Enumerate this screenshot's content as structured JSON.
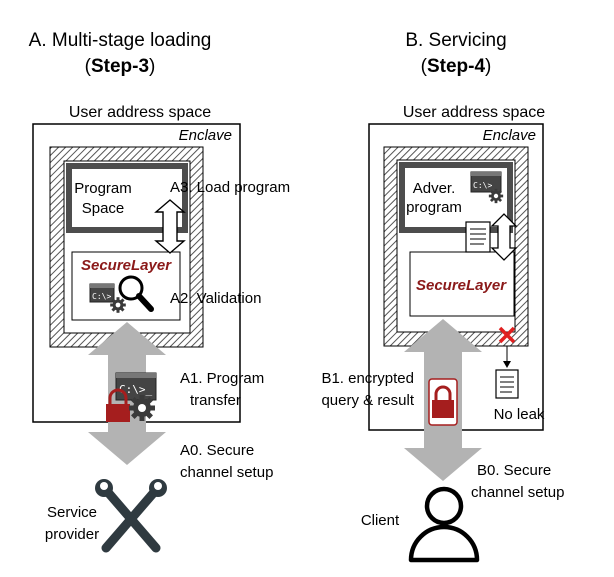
{
  "panel_a": {
    "title": "A. Multi-stage loading",
    "step_label": "Step-3",
    "user_space": "User address space",
    "enclave": "Enclave",
    "program_space_1": "Program",
    "program_space_2": "Space",
    "securelayer": "SecureLayer",
    "a3": "A3. Load program",
    "a2": "A2. Validation",
    "a1_1": "A1. Program",
    "a1_2": "transfer",
    "a0_1": "A0. Secure",
    "a0_2": "channel setup",
    "provider_1": "Service",
    "provider_2": "provider"
  },
  "panel_b": {
    "title": "B. Servicing",
    "step_label": "Step-4",
    "user_space": "User address space",
    "enclave": "Enclave",
    "adver_1": "Adver.",
    "adver_2": "program",
    "securelayer": "SecureLayer",
    "b1_1": "B1. encrypted",
    "b1_2": "query & result",
    "no_leak": "No leak",
    "b0_1": "B0. Secure",
    "b0_2": "channel setup",
    "client": "Client"
  },
  "icons": [
    "terminal-icon",
    "gear-icon",
    "magnifier-icon",
    "padlock-icon",
    "wrench-icon",
    "document-icon",
    "cross-icon",
    "person-icon"
  ],
  "colors": {
    "securelayer_text": "#8b1a1a",
    "arrow_gray": "#b3b3b3",
    "lock_red": "#a51e1e",
    "cross_red": "#e02020",
    "dark_frame": "#4d4d4d"
  }
}
